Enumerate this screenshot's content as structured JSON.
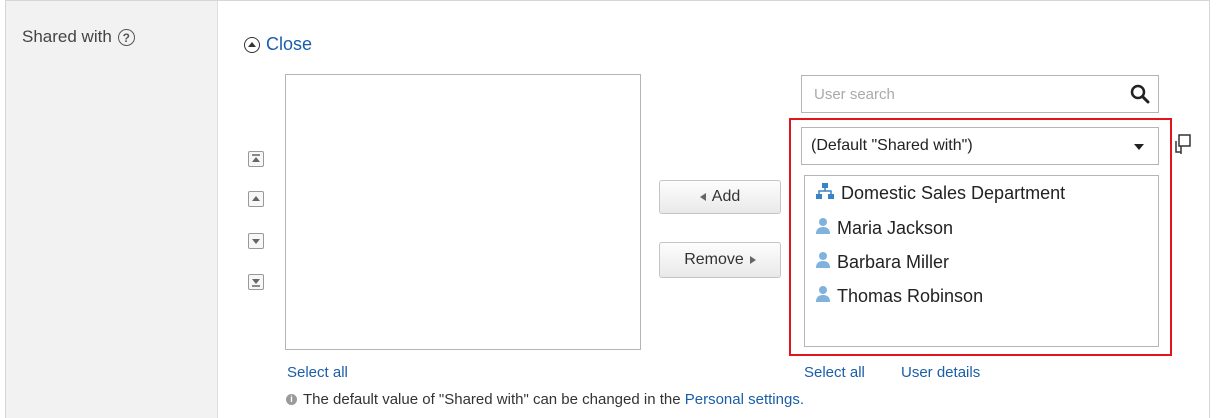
{
  "field": {
    "label": "Shared with",
    "help_icon": "question-circle-icon"
  },
  "close_label": "Close",
  "order_buttons": [
    "move-to-top-icon",
    "move-up-icon",
    "move-down-icon",
    "move-to-bottom-icon"
  ],
  "buttons": {
    "add_label": "Add",
    "remove_label": "Remove"
  },
  "search": {
    "placeholder": "User search",
    "icon": "search-icon"
  },
  "group_select": {
    "selected": "(Default \"Shared with\")"
  },
  "candidates": [
    {
      "label": "Domestic Sales Department",
      "icon": "organization-icon"
    },
    {
      "label": "Maria Jackson",
      "icon": "user-icon"
    },
    {
      "label": "Barbara Miller",
      "icon": "user-icon"
    },
    {
      "label": "Thomas Robinson",
      "icon": "user-icon"
    }
  ],
  "links": {
    "select_all_left": "Select all",
    "select_all_right": "Select all",
    "user_details": "User details"
  },
  "note": {
    "text": "The default value of \"Shared with\" can be changed in the",
    "link": "Personal settings."
  },
  "colors": {
    "link": "#1a5ea8",
    "highlight": "#e2151b",
    "label_bg": "#f2f2f2",
    "user_icon": "#7fb2dd"
  }
}
